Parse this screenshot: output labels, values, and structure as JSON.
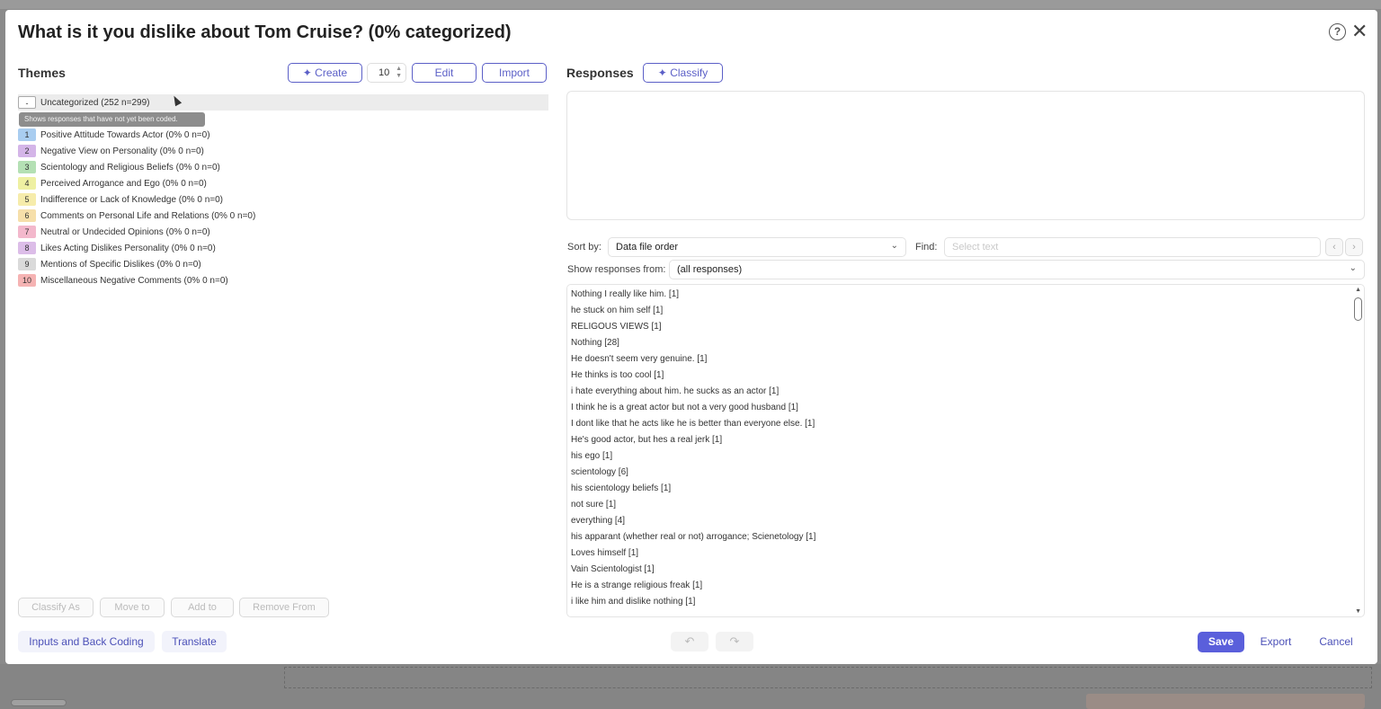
{
  "dialog": {
    "title": "What is it you dislike about Tom Cruise? (0% categorized)"
  },
  "themes": {
    "heading": "Themes",
    "create_label": "Create",
    "count_value": "10",
    "edit_label": "Edit",
    "import_label": "Import",
    "uncategorized": {
      "marker": "-",
      "label": "Uncategorized (252 n=299)"
    },
    "tooltip": "Shows responses that have not yet been coded.",
    "items": [
      {
        "num": "1",
        "label": "Positive Attitude Towards Actor (0% 0 n=0)",
        "color": "#a9cdf0"
      },
      {
        "num": "2",
        "label": "Negative View on Personality (0% 0 n=0)",
        "color": "#d4b5e8"
      },
      {
        "num": "3",
        "label": "Scientology and Religious Beliefs (0% 0 n=0)",
        "color": "#b4e0b4"
      },
      {
        "num": "4",
        "label": "Perceived Arrogance and Ego (0% 0 n=0)",
        "color": "#eef0a2"
      },
      {
        "num": "5",
        "label": "Indifference or Lack of Knowledge (0% 0 n=0)",
        "color": "#f6ecab"
      },
      {
        "num": "6",
        "label": "Comments on Personal Life and Relations (0% 0 n=0)",
        "color": "#f6dfaa"
      },
      {
        "num": "7",
        "label": "Neutral or Undecided Opinions (0% 0 n=0)",
        "color": "#f3b8cc"
      },
      {
        "num": "8",
        "label": "Likes Acting Dislikes Personality (0% 0 n=0)",
        "color": "#dcbde8"
      },
      {
        "num": "9",
        "label": "Mentions of Specific Dislikes (0% 0 n=0)",
        "color": "#dadada"
      },
      {
        "num": "10",
        "label": "Miscellaneous Negative Comments (0% 0 n=0)",
        "color": "#f5b3b3"
      }
    ],
    "actions": {
      "classify_as": "Classify As",
      "move_to": "Move to",
      "add_to": "Add to",
      "remove_from": "Remove From"
    }
  },
  "footer": {
    "inputs_back_coding": "Inputs and Back Coding",
    "translate": "Translate",
    "undo_icon": "↶",
    "redo_icon": "↷",
    "save": "Save",
    "export": "Export",
    "cancel": "Cancel"
  },
  "responses": {
    "heading": "Responses",
    "classify_label": "Classify",
    "sort_by_label": "Sort by:",
    "sort_by_value": "Data file order",
    "find_label": "Find:",
    "find_placeholder": "Select text",
    "show_from_label": "Show responses from:",
    "show_from_value": "(all responses)",
    "items": [
      "Nothing I really like him. [1]",
      "he stuck on him self [1]",
      "RELIGOUS VIEWS [1]",
      "Nothing [28]",
      "He doesn't seem very genuine. [1]",
      "He thinks is too cool [1]",
      "i hate everything about him. he sucks as an actor [1]",
      "I think he is a great actor but not a very good husband [1]",
      "I dont like that he acts like he is better than everyone else. [1]",
      "He's good actor, but hes a real jerk [1]",
      "his ego [1]",
      "scientology [6]",
      "his scientology beliefs [1]",
      "not sure [1]",
      "everything [4]",
      "his apparant (whether real or not) arrogance; Scienetology [1]",
      "Loves himself [1]",
      "Vain Scientologist [1]",
      "He is a strange religious freak [1]",
      "i like him and dislike nothing [1]"
    ]
  }
}
